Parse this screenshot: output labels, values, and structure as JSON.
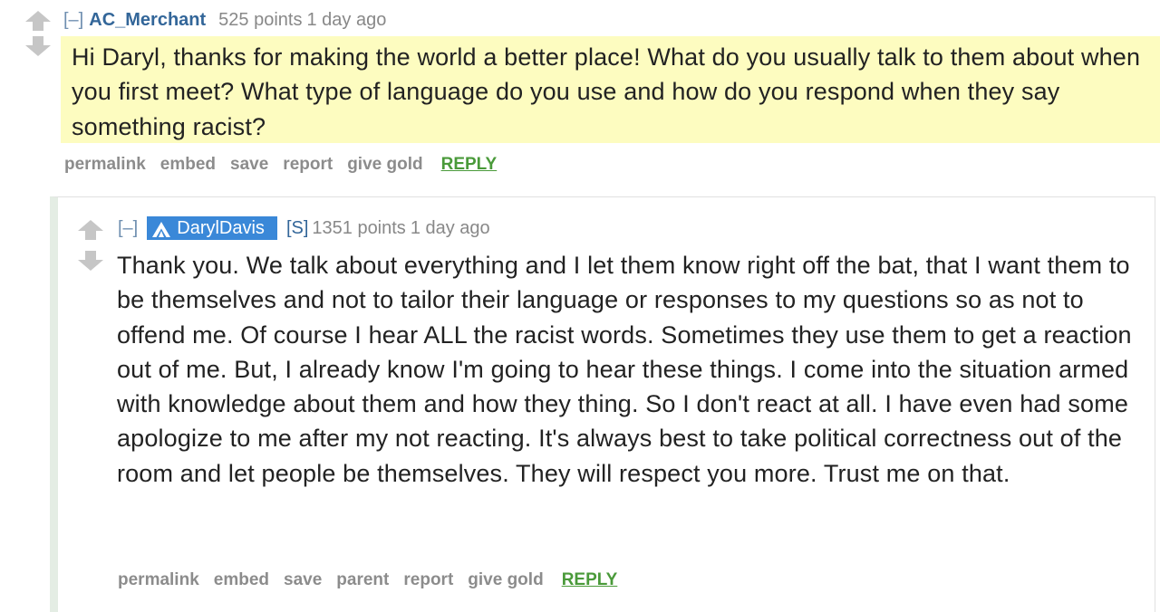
{
  "comment": {
    "toggle": "[–]",
    "author": "AC_Merchant",
    "score": "525 points",
    "time": "1 day ago",
    "body": "Hi Daryl, thanks for making the world a better place! What do you usually talk to them about when you first meet? What type of language do you use and how do you respond when they say something racist?",
    "buttons": {
      "permalink": "permalink",
      "embed": "embed",
      "save": "save",
      "report": "report",
      "give_gold": "give gold",
      "reply": "REPLY"
    }
  },
  "reply": {
    "toggle": "[–]",
    "author": "DarylDavis",
    "submitter_tag": "[S]",
    "score": "1351 points",
    "time": "1 day ago",
    "body": "Thank you. We talk about everything and I let them know right off the bat, that I want them to be themselves and not to tailor their language or responses to my questions so as not to offend me. Of course I hear ALL the racist words. Sometimes they use them to get a reaction out of me. But, I already know I'm going to hear these things. I come into the situation armed with knowledge about them and how they thing. So I don't react at all. I have even had some apologize to me after my not reacting. It's always best to take political correctness out of the room and let people be themselves. They will respect you more. Trust me on that.",
    "buttons": {
      "permalink": "permalink",
      "embed": "embed",
      "save": "save",
      "parent": "parent",
      "report": "report",
      "give_gold": "give gold",
      "reply": "REPLY"
    }
  },
  "colors": {
    "highlight_background": "#fdfcc0",
    "flair_background": "#3a88d8",
    "author_link": "#336699",
    "reply_link": "#4a9a3a",
    "muted_text": "#888888"
  },
  "icons": {
    "upvote": "upvote-arrow-icon",
    "downvote": "downvote-arrow-icon",
    "flair": "verified-a-icon"
  }
}
